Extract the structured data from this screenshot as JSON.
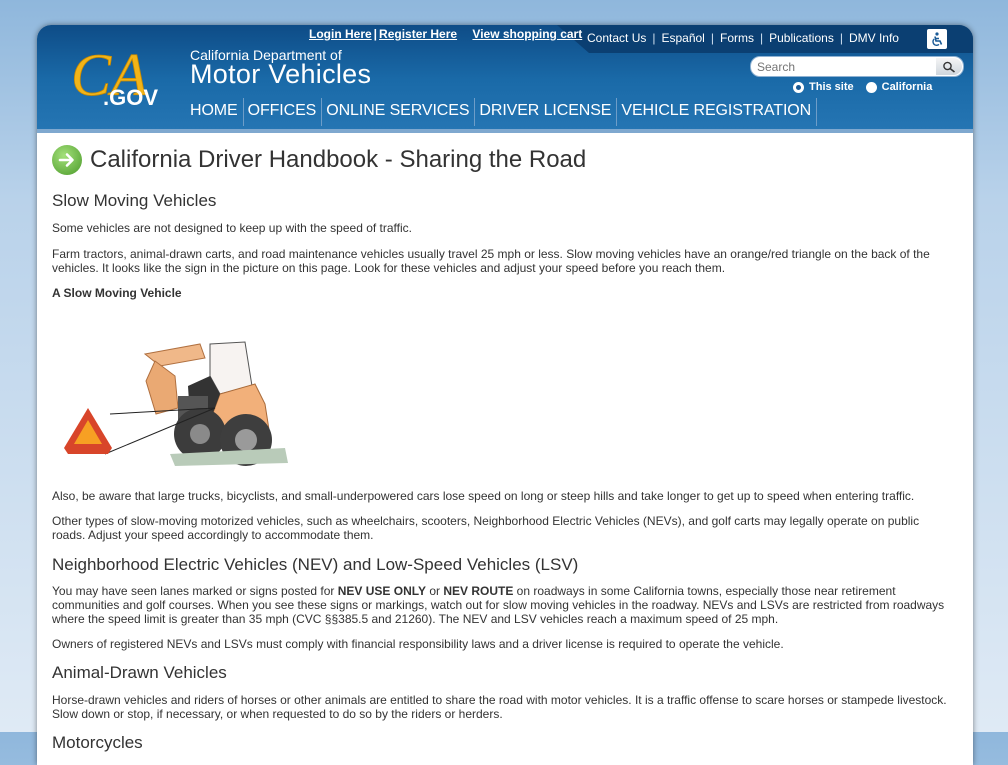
{
  "header": {
    "top_links": [
      "Login Here",
      "Register Here"
    ],
    "cart_link": "View shopping cart",
    "util_links": [
      "Contact Us",
      "Español",
      "Forms",
      "Publications",
      "DMV Info"
    ],
    "logo_ca": "CA",
    "logo_gov": ".GOV",
    "dept_line": "California Department of",
    "dept_name": "Motor Vehicles",
    "search_placeholder": "Search",
    "radio_this_site": "This site",
    "radio_california": "California",
    "nav": [
      "HOME",
      "OFFICES",
      "ONLINE SERVICES",
      "DRIVER LICENSE",
      "VEHICLE REGISTRATION"
    ]
  },
  "page": {
    "title": "California Driver Handbook - Sharing the Road",
    "sections": {
      "slow_heading": "Slow Moving Vehicles",
      "slow_p1": "Some vehicles are not designed to keep up with the speed of traffic.",
      "slow_p2": "Farm tractors, animal-drawn carts, and road maintenance vehicles usually travel 25 mph or less. Slow moving vehicles have an orange/red triangle on the back of the vehicles. It looks like the sign in the picture on this page. Look for these vehicles and adjust your speed before you reach them.",
      "figure_caption": "A Slow Moving Vehicle",
      "slow_p3": "Also, be aware that large trucks, bicyclists, and small-underpowered cars lose speed on long or steep hills and take longer to get up to speed when entering traffic.",
      "slow_p4": "Other types of slow-moving motorized vehicles, such as wheelchairs, scooters, Neighborhood Electric Vehicles (NEVs), and golf carts may legally operate on public roads. Adjust your speed accordingly to accommodate them.",
      "nev_heading": "Neighborhood Electric Vehicles (NEV) and Low-Speed Vehicles (LSV)",
      "nev_p1_a": "You may have seen lanes marked or signs posted for ",
      "nev_p1_b": "NEV USE ONLY",
      "nev_p1_c": " or ",
      "nev_p1_d": "NEV ROUTE",
      "nev_p1_e": " on roadways in some California towns, especially those near retirement communities and golf courses. When you see these signs or markings, watch out for slow moving vehicles in the roadway. NEVs and LSVs are restricted from roadways where the speed limit is greater than 35 mph (CVC §§385.5 and 21260). The NEV and LSV vehicles reach a maximum speed of 25 mph.",
      "nev_p2": "Owners of registered NEVs and LSVs must comply with financial responsibility laws and a driver license is required to operate the vehicle.",
      "animal_heading": "Animal-Drawn Vehicles",
      "animal_p1": "Horse-drawn vehicles and riders of horses or other animals are entitled to share the road with motor vehicles. It is a traffic offense to scare horses or stampede livestock. Slow down or stop, if necessary, or when requested to do so by the riders or herders.",
      "moto_heading": "Motorcycles"
    }
  },
  "colors": {
    "header_dark": "#0e4c87",
    "header_light": "#2575b3",
    "logo_gold": "#f2b418",
    "triangle_orange": "#f07d16",
    "triangle_red": "#d8452a"
  }
}
